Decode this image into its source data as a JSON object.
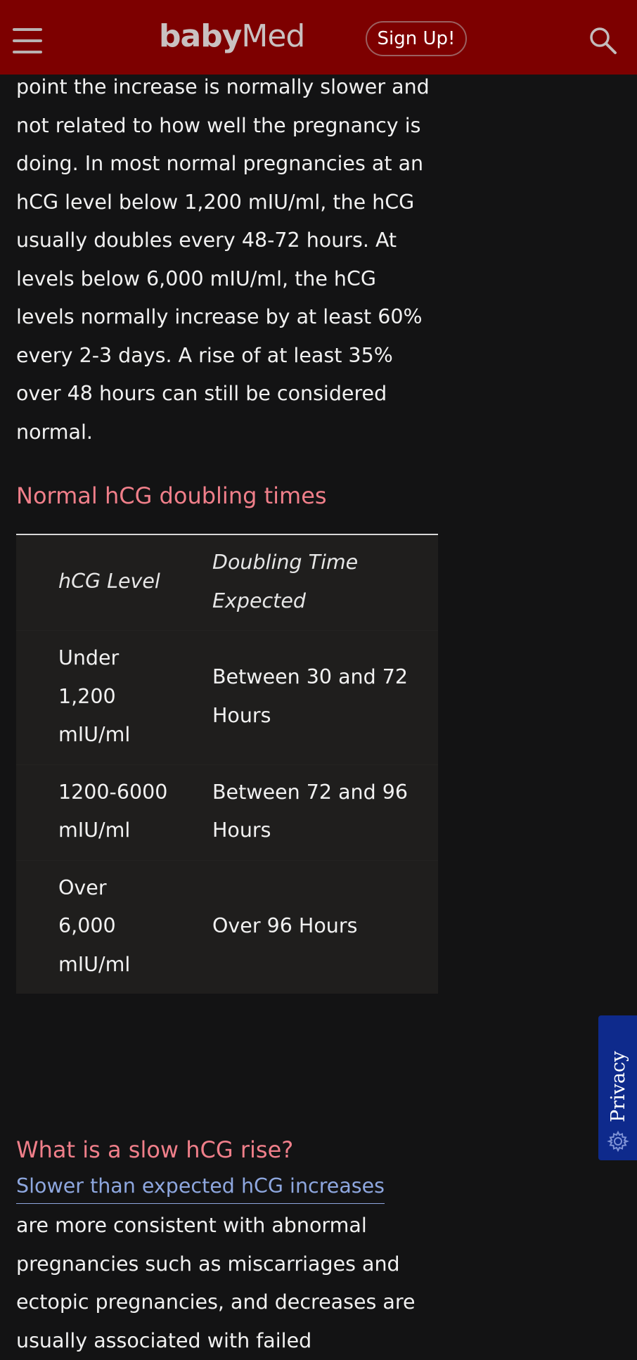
{
  "header": {
    "logo_bold": "baby",
    "logo_light": "Med",
    "signup_label": "Sign Up!",
    "menu_icon": "hamburger-menu-icon",
    "search_icon": "search-icon",
    "background_color": "#7d0000"
  },
  "article": {
    "intro_paragraph": "point the increase is normally slower and not related to how well the pregnancy is doing. In most normal pregnancies at an hCG level below 1,200 mIU/ml, the hCG usually doubles every 48-72 hours. At levels below 6,000 mIU/ml, the hCG levels normally increase by at least 60% every 2-3 days. A rise of at least 35% over 48 hours can still be considered normal.",
    "heading_doubling": "Normal hCG doubling times",
    "table": {
      "headers": [
        "hCG Level",
        "Doubling Time Expected"
      ],
      "rows": [
        [
          "Under 1,200 mIU/ml",
          "Between 30 and 72 Hours"
        ],
        [
          "1200-6000 mIU/ml",
          "Between 72 and 96 Hours"
        ],
        [
          "Over 6,000 mIU/ml",
          "Over 96 Hours"
        ]
      ]
    },
    "heading_slow": "What is a slow hCG rise?",
    "slow_link": "Slower than expected hCG increases",
    "slow_paragraph": "are more consistent with abnormal pregnancies such as miscarriages and ectopic pregnancies, and decreases are usually associated with failed"
  },
  "privacy": {
    "label": "Privacy",
    "icon": "gear-icon",
    "background_color": "#0e2a8c"
  },
  "colors": {
    "page_background": "#131314",
    "heading": "#f07f8a",
    "link": "#8ea7df",
    "table_background": "#1f1e1d"
  }
}
